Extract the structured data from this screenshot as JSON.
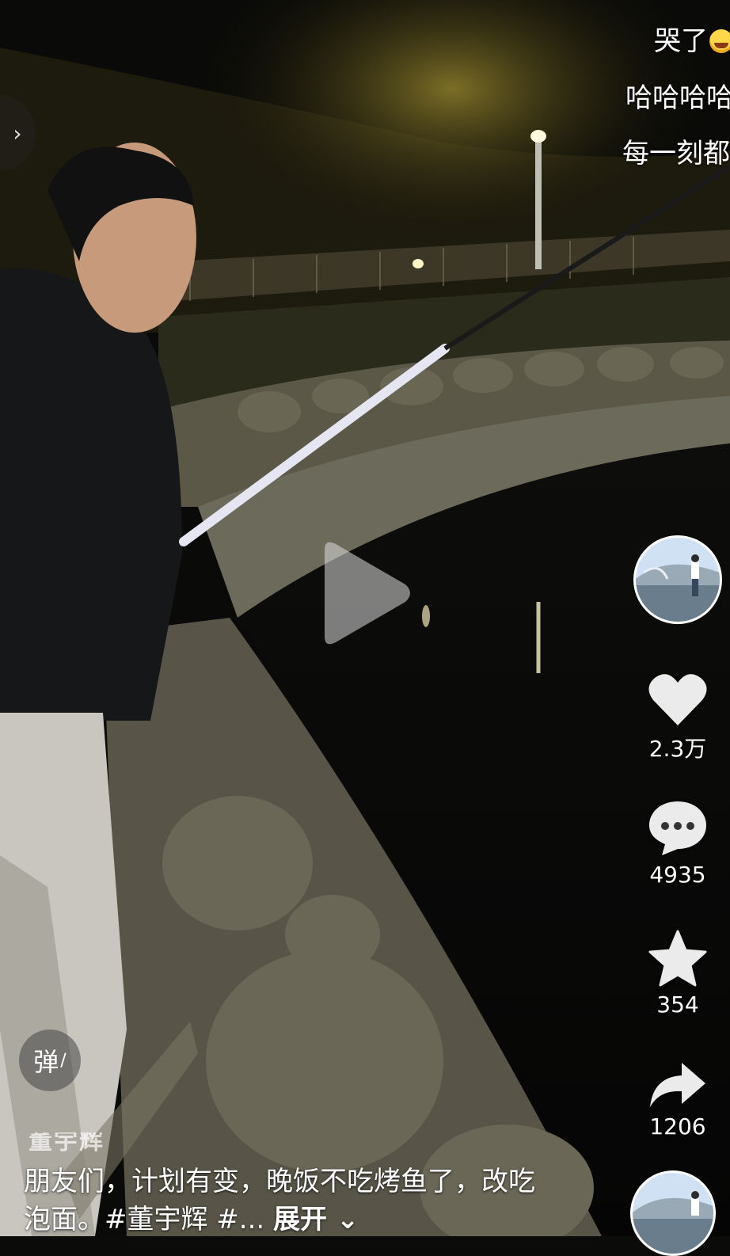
{
  "danmaku": [
    {
      "text": "哭了"
    },
    {
      "text": "哈哈哈哈"
    },
    {
      "text": "每一刻都"
    }
  ],
  "actions": {
    "like_count": "2.3万",
    "comment_count": "4935",
    "favorite_count": "354",
    "share_count": "1206"
  },
  "danmu_toggle_label": "弹",
  "author_name": "董宇辉",
  "caption": {
    "text": "朋友们，计划有变，晚饭不吃烤鱼了，改吃泡面。#董宇辉 #...",
    "expand_label": "展开"
  },
  "icons": {
    "back": "chevron-right-icon",
    "play": "play-icon",
    "like": "heart-icon",
    "comment": "comment-bubble-icon",
    "favorite": "star-icon",
    "share": "share-arrow-icon"
  },
  "colors": {
    "overlay_text": "#ffffff",
    "background": "#0b0c0a"
  }
}
